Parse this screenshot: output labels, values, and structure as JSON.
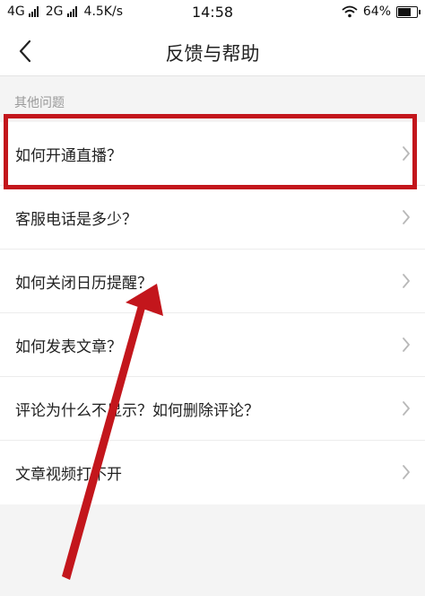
{
  "status_bar": {
    "network_1": "4G",
    "network_2": "2G",
    "speed": "4.5K/s",
    "time": "14:58",
    "battery": "64%",
    "battery_level": 0.64
  },
  "header": {
    "title": "反馈与帮助",
    "back_icon": "chevron-left-icon"
  },
  "section": {
    "title": "其他问题"
  },
  "faq_items": [
    {
      "label": "如何开通直播？"
    },
    {
      "label": "客服电话是多少？"
    },
    {
      "label": "如何关闭日历提醒？"
    },
    {
      "label": "如何发表文章？"
    },
    {
      "label": "评论为什么不显示？如何删除评论？"
    },
    {
      "label": "文章视频打不开"
    }
  ],
  "annotation": {
    "highlight_color": "#c3161c"
  }
}
